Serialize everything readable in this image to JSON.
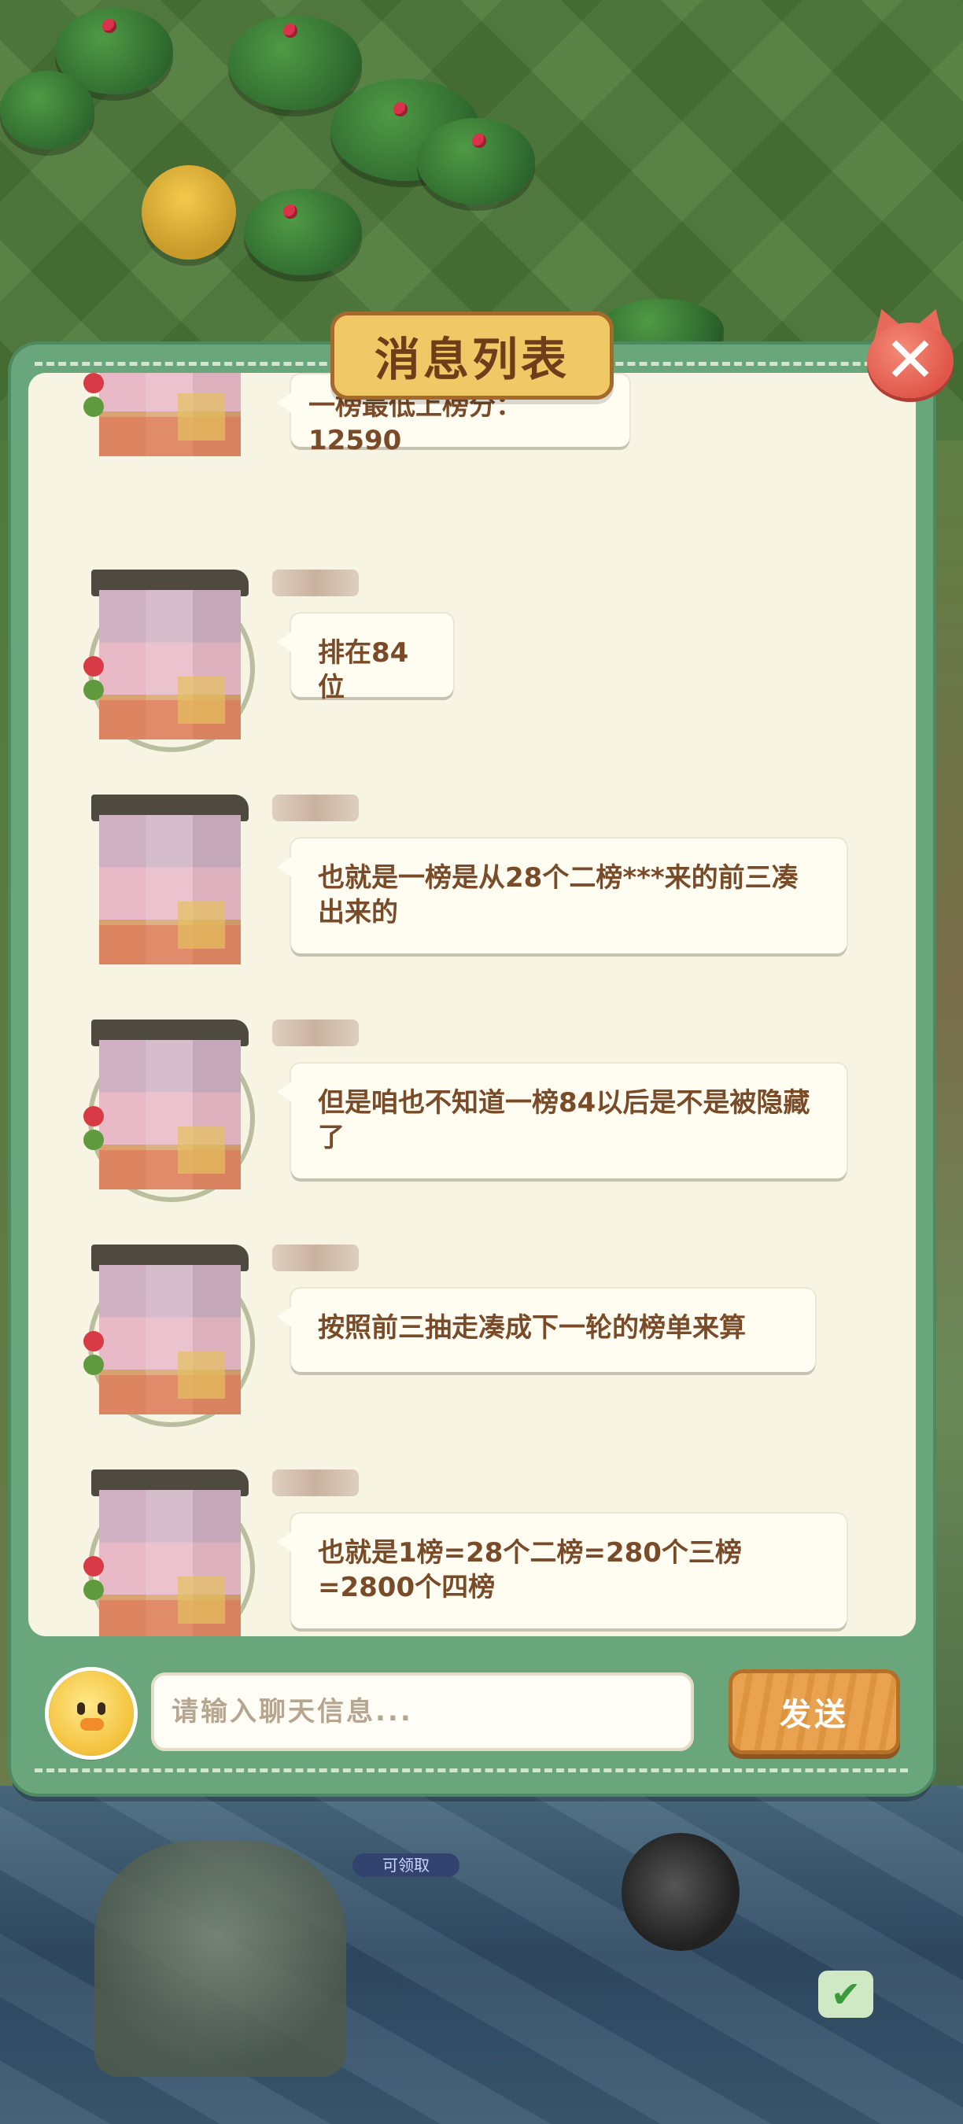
{
  "background": {
    "claim_label": "可领取"
  },
  "dialog": {
    "title": "消息列表",
    "close_label": "✕"
  },
  "messages": [
    {
      "text": "一榜最低上榜分：12590"
    },
    {
      "text": "排在84位"
    },
    {
      "text": "也就是一榜是从28个二榜***来的前三凑出来的"
    },
    {
      "text": "但是咱也不知道一榜84以后是不是被隐藏了"
    },
    {
      "text": "按照前三抽走凑成下一轮的榜单来算"
    },
    {
      "text": "也就是1榜=28个二榜=280个三榜=2800个四榜"
    }
  ],
  "input": {
    "placeholder": "请输入聊天信息...",
    "value": ""
  },
  "send_button": {
    "label": "发送"
  },
  "colors": {
    "panel_green": "#6aa67c",
    "panel_inner": "#f8f4e3",
    "title_gold": "#f1c866",
    "text_brown": "#7a4b28",
    "close_red": "#e0574a",
    "send_orange": "#e9a24f"
  },
  "icons": {
    "close": "cat-close-icon",
    "emoji": "chick-emoji-icon"
  }
}
